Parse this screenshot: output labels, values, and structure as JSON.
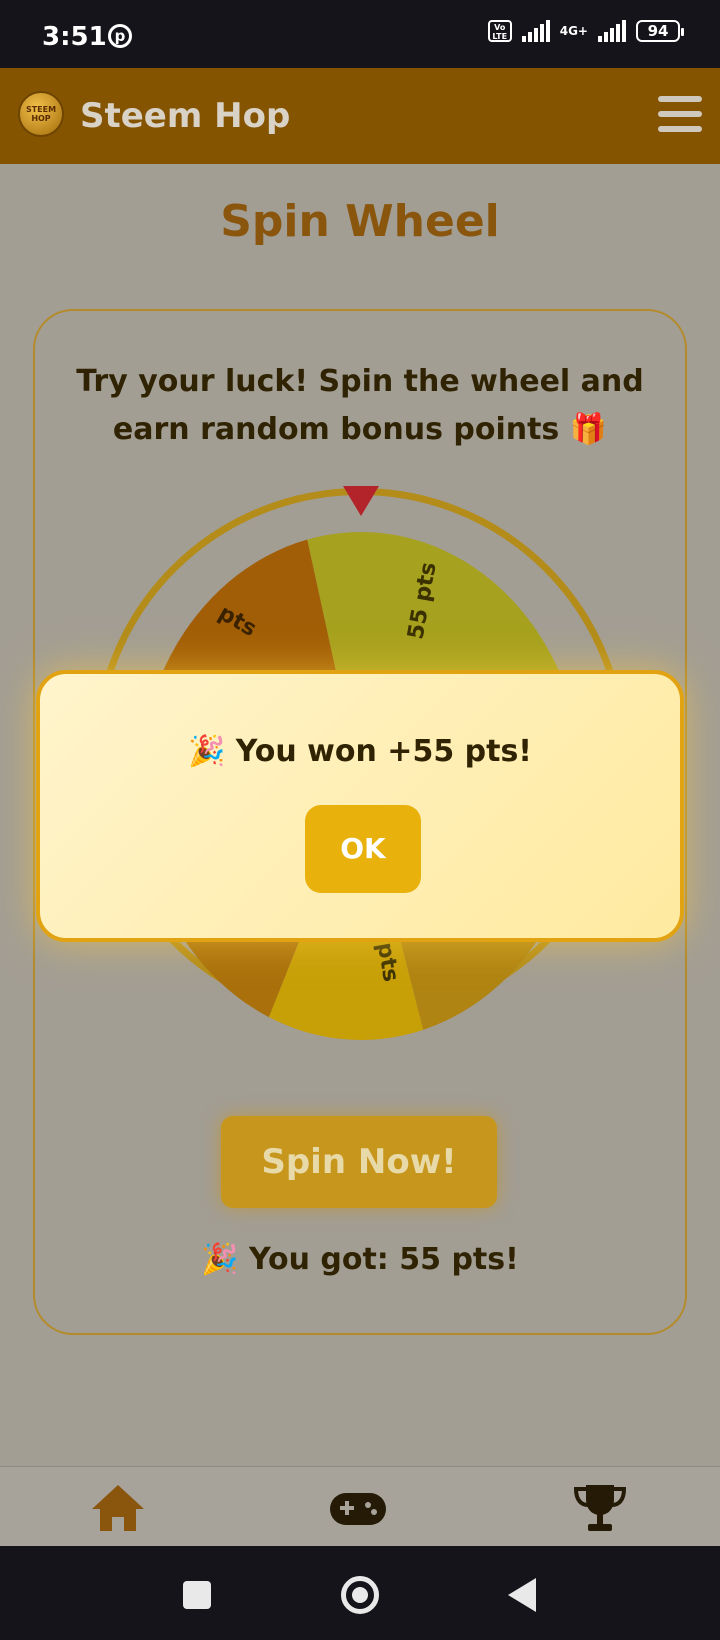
{
  "status_bar": {
    "time": "3:51",
    "volte_label": "Vo LTE",
    "network_type": "4G+",
    "battery_level": "94"
  },
  "header": {
    "app_title": "Steem Hop",
    "logo_text": "STEEM HOP"
  },
  "page": {
    "title": "Spin Wheel",
    "intro": "Try your luck! Spin the wheel and earn random bonus points 🎁",
    "spin_button_label": "Spin Now!",
    "result_text": "🎉 You got: 55 pts!"
  },
  "wheel": {
    "visible_labels": [
      "55 pts",
      "pts",
      "1 pts"
    ],
    "segment_colors": [
      "#a6a11e",
      "#a25e06",
      "#c79f07",
      "#b08412"
    ]
  },
  "dialog": {
    "message": "🎉 You won +55 pts!",
    "ok_label": "OK"
  },
  "bottom_nav": {
    "items": [
      "home-icon",
      "gamepad-icon",
      "trophy-icon"
    ],
    "active": "home-icon"
  }
}
